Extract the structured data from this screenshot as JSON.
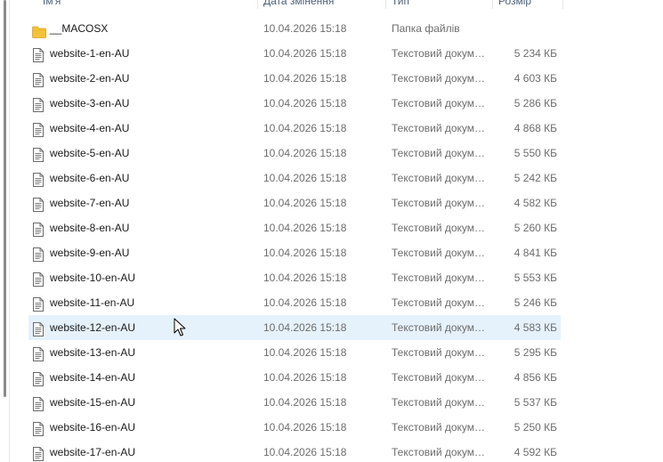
{
  "columns": {
    "name": "Ім'я",
    "date": "Дата змінення",
    "type": "Тип",
    "size": "Розмір"
  },
  "files": [
    {
      "name": "__MACOSX",
      "date": "10.04.2026 15:18",
      "type": "Папка файлів",
      "size": "",
      "icon": "folder-icon"
    },
    {
      "name": "website-1-en-AU",
      "date": "10.04.2026 15:18",
      "type": "Текстовий документ",
      "size": "5 234 КБ",
      "icon": "text-file-icon"
    },
    {
      "name": "website-2-en-AU",
      "date": "10.04.2026 15:18",
      "type": "Текстовий документ",
      "size": "4 603 КБ",
      "icon": "text-file-icon"
    },
    {
      "name": "website-3-en-AU",
      "date": "10.04.2026 15:18",
      "type": "Текстовий документ",
      "size": "5 286 КБ",
      "icon": "text-file-icon"
    },
    {
      "name": "website-4-en-AU",
      "date": "10.04.2026 15:18",
      "type": "Текстовий документ",
      "size": "4 868 КБ",
      "icon": "text-file-icon"
    },
    {
      "name": "website-5-en-AU",
      "date": "10.04.2026 15:18",
      "type": "Текстовий документ",
      "size": "5 550 КБ",
      "icon": "text-file-icon"
    },
    {
      "name": "website-6-en-AU",
      "date": "10.04.2026 15:18",
      "type": "Текстовий документ",
      "size": "5 242 КБ",
      "icon": "text-file-icon"
    },
    {
      "name": "website-7-en-AU",
      "date": "10.04.2026 15:18",
      "type": "Текстовий документ",
      "size": "4 582 КБ",
      "icon": "text-file-icon"
    },
    {
      "name": "website-8-en-AU",
      "date": "10.04.2026 15:18",
      "type": "Текстовий документ",
      "size": "5 260 КБ",
      "icon": "text-file-icon"
    },
    {
      "name": "website-9-en-AU",
      "date": "10.04.2026 15:18",
      "type": "Текстовий документ",
      "size": "4 841 КБ",
      "icon": "text-file-icon"
    },
    {
      "name": "website-10-en-AU",
      "date": "10.04.2026 15:18",
      "type": "Текстовий документ",
      "size": "5 553 КБ",
      "icon": "text-file-icon"
    },
    {
      "name": "website-11-en-AU",
      "date": "10.04.2026 15:18",
      "type": "Текстовий документ",
      "size": "5 246 КБ",
      "icon": "text-file-icon"
    },
    {
      "name": "website-12-en-AU",
      "date": "10.04.2026 15:18",
      "type": "Текстовий документ",
      "size": "4 583 КБ",
      "icon": "text-file-icon",
      "selected": true
    },
    {
      "name": "website-13-en-AU",
      "date": "10.04.2026 15:18",
      "type": "Текстовий документ",
      "size": "5 295 КБ",
      "icon": "text-file-icon"
    },
    {
      "name": "website-14-en-AU",
      "date": "10.04.2026 15:18",
      "type": "Текстовий документ",
      "size": "4 856 КБ",
      "icon": "text-file-icon"
    },
    {
      "name": "website-15-en-AU",
      "date": "10.04.2026 15:18",
      "type": "Текстовий документ",
      "size": "5 537 КБ",
      "icon": "text-file-icon"
    },
    {
      "name": "website-16-en-AU",
      "date": "10.04.2026 15:18",
      "type": "Текстовий документ",
      "size": "5 250 КБ",
      "icon": "text-file-icon"
    },
    {
      "name": "website-17-en-AU",
      "date": "10.04.2026 15:18",
      "type": "Текстовий документ",
      "size": "4 592 КБ",
      "icon": "text-file-icon"
    }
  ],
  "colors": {
    "selected_row": "#e5f1fb",
    "folder": "#f5c13b",
    "header_text": "#4c607a"
  }
}
